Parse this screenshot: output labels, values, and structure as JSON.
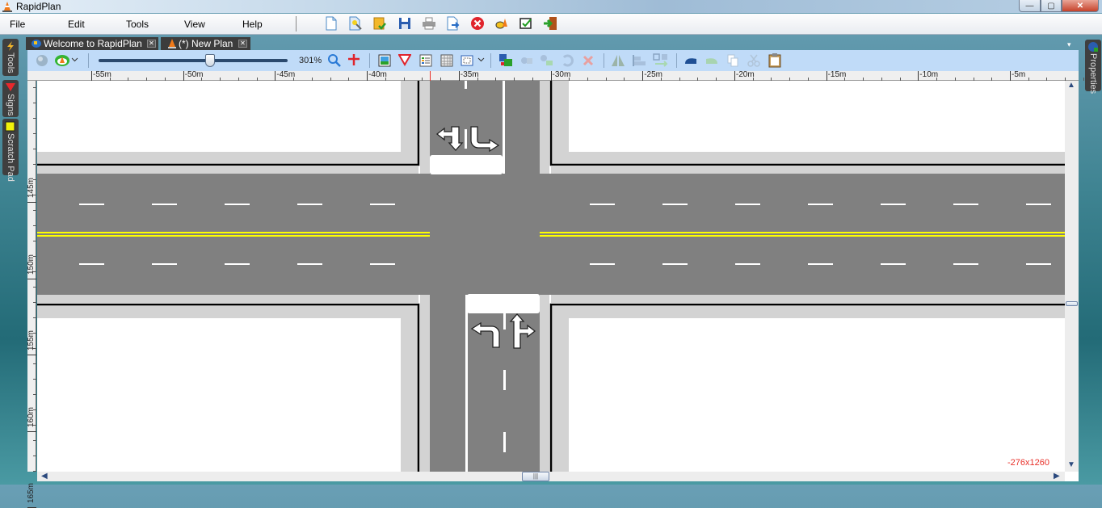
{
  "window": {
    "title": "RapidPlan",
    "controls": {
      "minimize": "—",
      "maximize": "▢",
      "close": "✕"
    }
  },
  "menu": {
    "items": [
      "File",
      "Edit",
      "Tools",
      "View",
      "Help"
    ]
  },
  "main_toolbar": {
    "icons": [
      "new-document-icon",
      "open-document-icon",
      "export-icon",
      "save-icon",
      "print-icon",
      "send-icon",
      "close-red-icon",
      "rapidplan-bee-icon",
      "checkbox-icon",
      "exit-door-icon"
    ]
  },
  "left_dock": {
    "tabs": [
      {
        "label": "Tools",
        "icon": "lightning-icon"
      },
      {
        "label": "Signs",
        "icon": "sign-triangle-icon"
      },
      {
        "label": "Scratch Pad",
        "icon": "notepad-icon"
      }
    ]
  },
  "right_dock": {
    "tabs": [
      {
        "label": "Properties",
        "icon": "properties-icon"
      }
    ]
  },
  "document_tabs": [
    {
      "label": "Welcome to RapidPlan",
      "icon": "globe-icon",
      "close": "✕"
    },
    {
      "label": "(*) New Plan",
      "icon": "traffic-cone-icon",
      "close": "✕"
    }
  ],
  "view_menu_glyph": "▾",
  "plan_toolbar": {
    "zoom_percent": "301%",
    "zoom_slider_fraction": 0.59,
    "icons": [
      "globe-icon",
      "layer-dropdown-icon",
      "magnifier-icon",
      "crosshair-icon",
      "background-image-icon",
      "yield-sign-icon",
      "list-icon",
      "grid-icon",
      "frame-dropdown-icon",
      "select-region-icon",
      "move-back-icon",
      "move-front-icon",
      "rotate-icon",
      "delete-icon",
      "flip-icon",
      "align-icon",
      "distribute-icon",
      "undo-icon",
      "redo-icon",
      "copy-icon",
      "cut-icon",
      "paste-icon"
    ]
  },
  "ruler_top": {
    "labels": [
      "-55m",
      "-50m",
      "-45m",
      "-40m",
      "-35m",
      "-30m",
      "-25m",
      "-20m",
      "-15m",
      "-10m",
      "-5m"
    ]
  },
  "ruler_left": {
    "labels": [
      "145m",
      "150m",
      "155m",
      "160m",
      "165m"
    ]
  },
  "canvas": {
    "coordinate_readout": "-276x1260",
    "colors": {
      "asphalt": "#808080",
      "curb": "#d3d3d3",
      "lot": "#ffffff",
      "center_line": "#ffff00",
      "lane_mark": "#ffffff"
    },
    "markings": [
      {
        "name": "left-turn-straight-arrow",
        "lane": "southbound-left"
      },
      {
        "name": "right-turn-arrow",
        "lane": "southbound-right"
      },
      {
        "name": "left-turn-arrow",
        "lane": "northbound-left"
      },
      {
        "name": "straight-right-arrow",
        "lane": "northbound-right"
      }
    ]
  },
  "scrollbars": {
    "up": "▲",
    "down": "▼",
    "left": "◀",
    "right": "▶",
    "thumb_grip": "|||"
  }
}
